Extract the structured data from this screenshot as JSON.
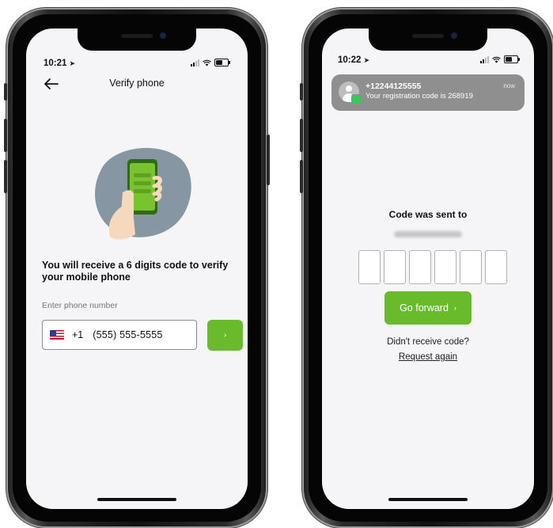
{
  "left_screen": {
    "status": {
      "time": "10:21"
    },
    "nav": {
      "title": "Verify phone"
    },
    "headline": "You will receive a 6 digits code to verify your mobile phone",
    "field_label": "Enter phone number",
    "phone_input": {
      "country": "US",
      "dial_code": "+1",
      "value": "(555) 555-5555"
    },
    "next_button": {
      "label": "›"
    },
    "colors": {
      "accent": "#6abb2b"
    },
    "icons": [
      "back-arrow-icon",
      "us-flag-icon",
      "phone-illustration"
    ]
  },
  "right_screen": {
    "status": {
      "time": "10:22"
    },
    "notification": {
      "sender": "+12244125555",
      "message": "Your registration code is 268919",
      "time": "now"
    },
    "title": "Code was sent to",
    "code_boxes": [
      "",
      "",
      "",
      "",
      "",
      ""
    ],
    "primary_button": {
      "label": "Go forward",
      "arrow": "›"
    },
    "no_code_text": "Didn't receive code?",
    "request_link": "Request again",
    "colors": {
      "accent": "#6abb2b"
    }
  }
}
